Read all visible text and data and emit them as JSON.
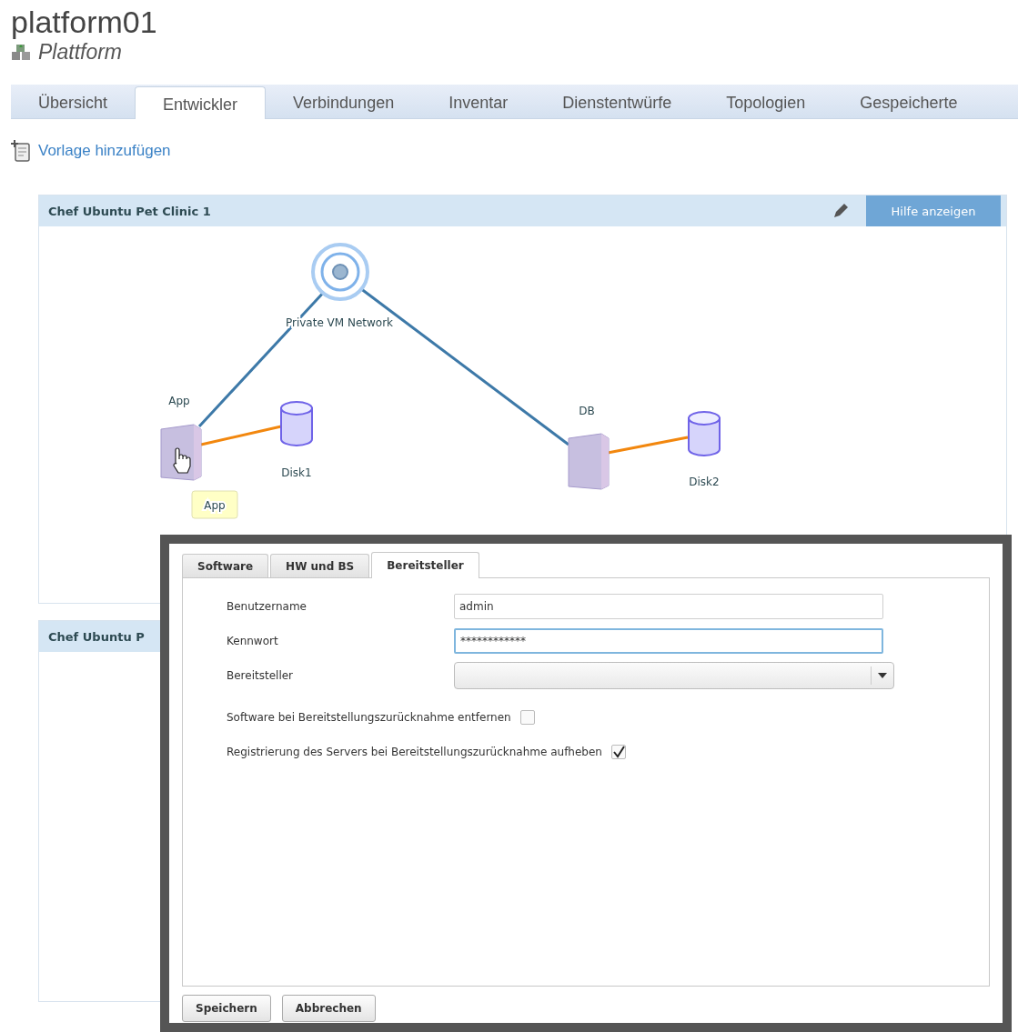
{
  "header": {
    "title": "platform01",
    "subtitle": "Plattform"
  },
  "tabs": [
    {
      "label": "Übersicht",
      "selected": false
    },
    {
      "label": "Entwickler",
      "selected": true
    },
    {
      "label": "Verbindungen",
      "selected": false
    },
    {
      "label": "Inventar",
      "selected": false
    },
    {
      "label": "Dienstentwürfe",
      "selected": false
    },
    {
      "label": "Topologien",
      "selected": false
    },
    {
      "label": "Gespeicherte",
      "selected": false
    }
  ],
  "add_link": "Vorlage hinzufügen",
  "panels": [
    {
      "title": "Chef Ubuntu Pet Clinic 1",
      "help_button": "Hilfe anzeigen",
      "diagram": {
        "nodes": [
          {
            "kind": "network",
            "label": "Private VM Network"
          },
          {
            "kind": "server",
            "label": "App"
          },
          {
            "kind": "disk",
            "label": "Disk1"
          },
          {
            "kind": "server",
            "label": "DB"
          },
          {
            "kind": "disk",
            "label": "Disk2"
          }
        ],
        "links": [
          {
            "kind": "network"
          },
          {
            "kind": "network"
          },
          {
            "kind": "storage"
          },
          {
            "kind": "storage"
          }
        ],
        "tooltip": "App"
      }
    },
    {
      "title": "Chef Ubuntu P"
    }
  ],
  "dialog": {
    "tabs": [
      {
        "label": "Software",
        "selected": false
      },
      {
        "label": "HW und BS",
        "selected": false
      },
      {
        "label": "Bereitsteller",
        "selected": true
      }
    ],
    "fields": [
      {
        "kind": "text",
        "label": "Benutzername",
        "value": "admin",
        "focused": false
      },
      {
        "kind": "text",
        "label": "Kennwort",
        "value": "************",
        "focused": true
      },
      {
        "kind": "select",
        "label": "Bereitsteller",
        "focused": false
      }
    ],
    "checkboxes": [
      {
        "label": "Software bei Bereitstellungszurücknahme entfernen",
        "checked": false
      },
      {
        "label": "Registrierung des Servers bei Bereitstellungszurücknahme aufheben",
        "checked": true
      }
    ],
    "buttons": [
      "Speichern",
      "Abbrechen"
    ]
  }
}
